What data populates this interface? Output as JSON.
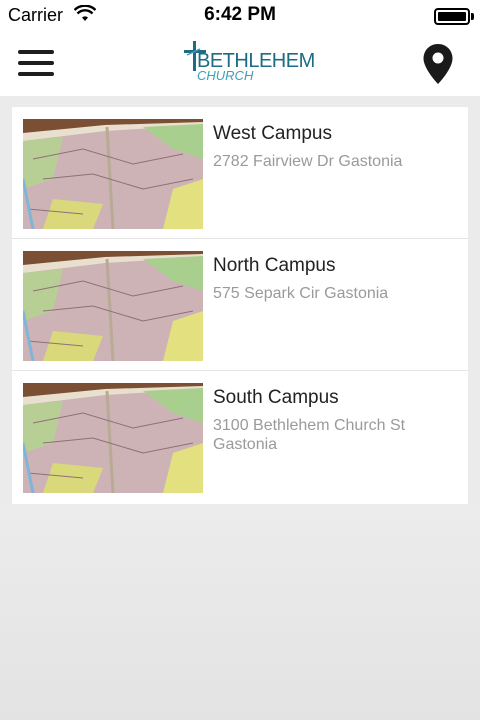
{
  "status_bar": {
    "carrier": "Carrier",
    "time": "6:42 PM",
    "wifi_icon": "wifi-icon",
    "battery_icon": "battery-icon"
  },
  "nav": {
    "menu_icon": "hamburger-menu-icon",
    "logo_line1": "BETHLEHEM",
    "logo_line2": "CHURCH",
    "location_icon": "map-pin-icon",
    "logo_color": "#1d6b84",
    "logo_accent": "#3aa0bd"
  },
  "campuses": [
    {
      "name": "West Campus",
      "address": "2782 Fairview Dr Gastonia",
      "image": "map-atlas-image"
    },
    {
      "name": "North Campus",
      "address": "575 Separk Cir Gastonia",
      "image": "map-atlas-image"
    },
    {
      "name": "South Campus",
      "address": "3100 Bethlehem Church St Gastonia",
      "image": "map-atlas-image"
    }
  ]
}
